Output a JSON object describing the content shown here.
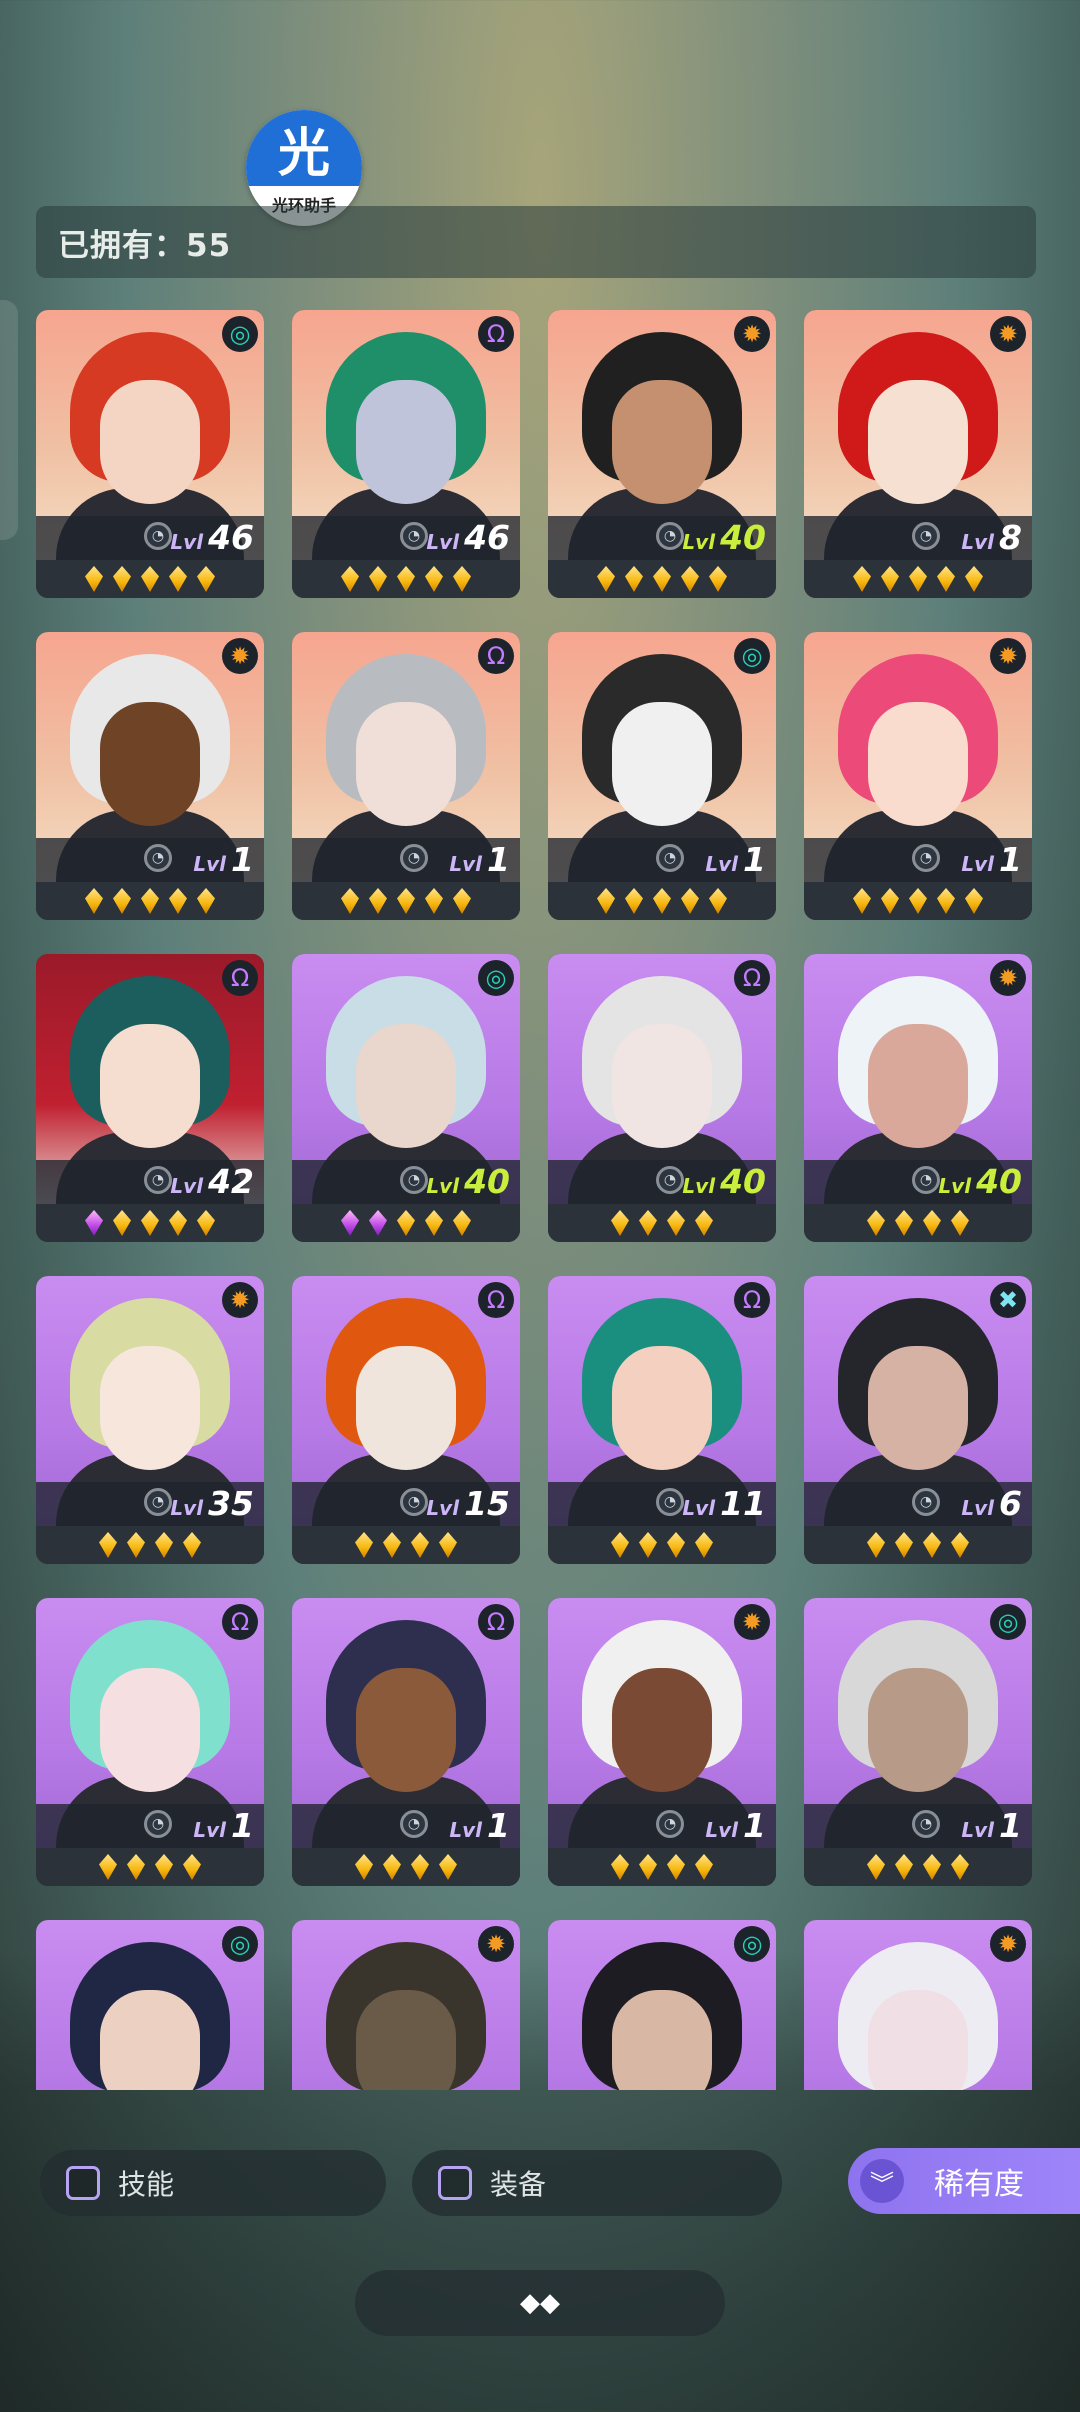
{
  "header": {
    "owned_text": "已拥有：55",
    "logo_char": "光",
    "logo_text": "光环助手"
  },
  "colors": {
    "accent": "#a086fa",
    "level_highlight": "#c9ef3c",
    "gem_gold": "#f7b70e",
    "gem_purple": "#c04ae6"
  },
  "cards": [
    {
      "element": "flow-icon",
      "level_prefix": "Lvl",
      "level": "46",
      "gems": "ggggg",
      "hair": "#d63a22",
      "skin": "#f4d5c4",
      "bg": "sun"
    },
    {
      "element": "void-icon",
      "level_prefix": "Lvl",
      "level": "46",
      "gems": "ggggg",
      "hair": "#1f8f6a",
      "skin": "#bfc4da",
      "bg": "sun"
    },
    {
      "element": "sun-icon",
      "level_prefix": "Lvl",
      "level": "40",
      "gems": "ggggg",
      "hair": "#202020",
      "skin": "#c49070",
      "bg": "sun"
    },
    {
      "element": "sun-icon",
      "level_prefix": "Lvl",
      "level": "8",
      "gems": "ggggg",
      "hair": "#d01a1a",
      "skin": "#f5e0d2",
      "bg": "sun"
    },
    {
      "element": "sun-icon",
      "level_prefix": "Lvl",
      "level": "1",
      "gems": "ggggg",
      "hair": "#e8e8e8",
      "skin": "#6e4326",
      "bg": "sun"
    },
    {
      "element": "void-icon",
      "level_prefix": "Lvl",
      "level": "1",
      "gems": "ggggg",
      "hair": "#b8bcc0",
      "skin": "#f0dfd8",
      "bg": "sun"
    },
    {
      "element": "flow-icon",
      "level_prefix": "Lvl",
      "level": "1",
      "gems": "ggggg",
      "hair": "#2a2a2a",
      "skin": "#f0f0f0",
      "bg": "sun"
    },
    {
      "element": "sun-icon",
      "level_prefix": "Lvl",
      "level": "1",
      "gems": "ggggg",
      "hair": "#ec4a78",
      "skin": "#f9dccd",
      "bg": "sun"
    },
    {
      "element": "void-icon",
      "level_prefix": "Lvl",
      "level": "42",
      "gems": "pgggg",
      "hair": "#1c5d5d",
      "skin": "#f5ddd0",
      "bg": "red"
    },
    {
      "element": "flow-icon",
      "level_prefix": "Lvl",
      "level": "40",
      "gems": "ppggg",
      "hair": "#c9dde6",
      "skin": "#e9d6cc",
      "bg": "purple"
    },
    {
      "element": "void-icon",
      "level_prefix": "Lvl",
      "level": "40",
      "gems": "gggg",
      "hair": "#e4e4e4",
      "skin": "#f1e5e3",
      "bg": "purple"
    },
    {
      "element": "sun-icon",
      "level_prefix": "Lvl",
      "level": "40",
      "gems": "gggg",
      "hair": "#eef3f7",
      "skin": "#d9a89a",
      "bg": "purple"
    },
    {
      "element": "sun-icon",
      "level_prefix": "Lvl",
      "level": "35",
      "gems": "gggg",
      "hair": "#d8dba2",
      "skin": "#f7e6dc",
      "bg": "purple"
    },
    {
      "element": "void-icon",
      "level_prefix": "Lvl",
      "level": "15",
      "gems": "gggg",
      "hair": "#e0570f",
      "skin": "#f0e5dc",
      "bg": "purple"
    },
    {
      "element": "void-icon",
      "level_prefix": "Lvl",
      "level": "11",
      "gems": "gggg",
      "hair": "#1a8f80",
      "skin": "#f3d0c0",
      "bg": "purple"
    },
    {
      "element": "cross-icon",
      "level_prefix": "Lvl",
      "level": "6",
      "gems": "gggg",
      "hair": "#25262b",
      "skin": "#d5b2a3",
      "bg": "purple"
    },
    {
      "element": "void-icon",
      "level_prefix": "Lvl",
      "level": "1",
      "gems": "gggg",
      "hair": "#7fe0cd",
      "skin": "#f6dfe0",
      "bg": "purple"
    },
    {
      "element": "void-icon",
      "level_prefix": "Lvl",
      "level": "1",
      "gems": "gggg",
      "hair": "#2e2f4e",
      "skin": "#8a5a3a",
      "bg": "purple"
    },
    {
      "element": "sun-icon",
      "level_prefix": "Lvl",
      "level": "1",
      "gems": "gggg",
      "hair": "#f0f0f0",
      "skin": "#7a4a34",
      "bg": "purple"
    },
    {
      "element": "flow-icon",
      "level_prefix": "Lvl",
      "level": "1",
      "gems": "gggg",
      "hair": "#d8d8d8",
      "skin": "#b79a88",
      "bg": "purple"
    },
    {
      "element": "flow-icon",
      "level_prefix": "",
      "level": "",
      "gems": "",
      "hair": "#1f2745",
      "skin": "#ecd1c2",
      "bg": "purple"
    },
    {
      "element": "sun-icon",
      "level_prefix": "",
      "level": "",
      "gems": "",
      "hair": "#3a352c",
      "skin": "#6a5a48",
      "bg": "purple"
    },
    {
      "element": "flow-icon",
      "level_prefix": "",
      "level": "",
      "gems": "",
      "hair": "#1c1c22",
      "skin": "#d9b7a5",
      "bg": "purple"
    },
    {
      "element": "sun-icon",
      "level_prefix": "",
      "level": "",
      "gems": "",
      "hair": "#ececf2",
      "skin": "#f1dfe6",
      "bg": "purple"
    }
  ],
  "filters": {
    "skill_label": "技能",
    "equip_label": "装备",
    "rarity_label": "稀有度",
    "rarity_icon": "chevrons-down-icon",
    "bottom_icon": "diamond-cluster-icon"
  },
  "icons": {
    "flow-icon": "◎",
    "void-icon": "Ω",
    "sun-icon": "✹",
    "cross-icon": "✖"
  }
}
